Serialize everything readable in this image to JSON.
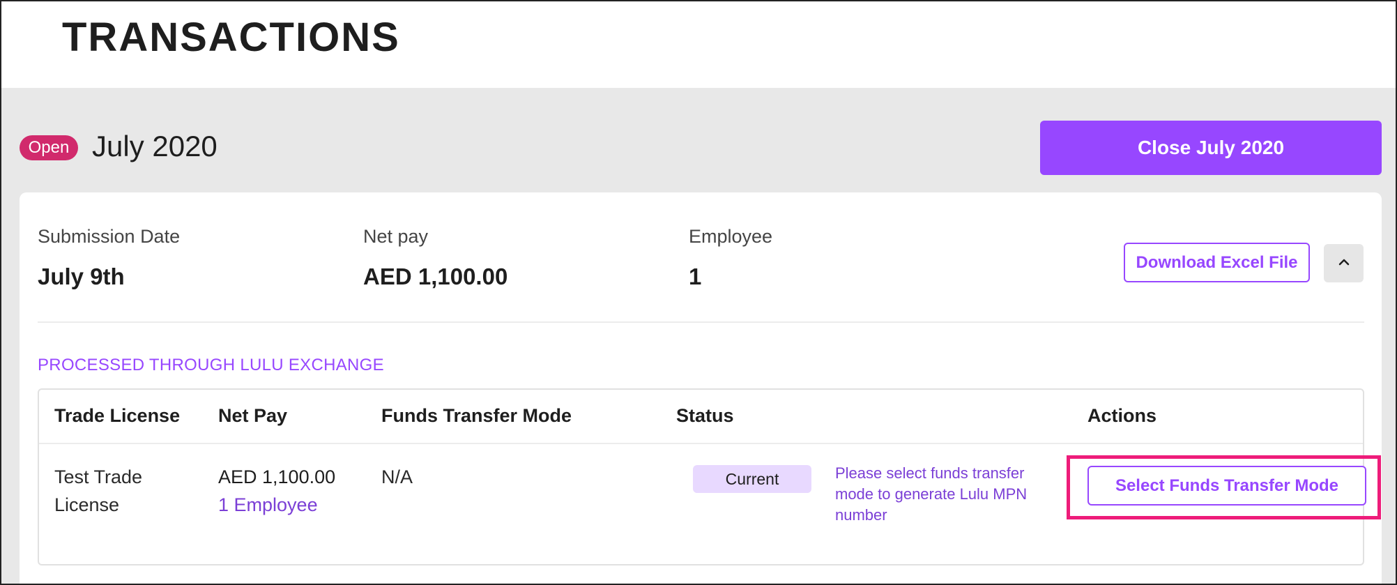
{
  "header": {
    "title": "TRANSACTIONS"
  },
  "period": {
    "status_badge": "Open",
    "title": "July 2020",
    "close_button_label": "Close July 2020"
  },
  "summary": {
    "submission_date_label": "Submission Date",
    "submission_date_value": "July 9th",
    "net_pay_label": "Net pay",
    "net_pay_value": "AED 1,100.00",
    "employee_label": "Employee",
    "employee_value": "1",
    "download_button_label": "Download Excel File",
    "collapse_icon": "chevron-up-icon"
  },
  "section": {
    "label": "PROCESSED THROUGH LULU EXCHANGE"
  },
  "table": {
    "headers": [
      "Trade License",
      "Net Pay",
      "Funds Transfer Mode",
      "Status",
      "Actions"
    ],
    "rows": [
      {
        "trade_license_line1": "Test Trade",
        "trade_license_line2": "License",
        "net_pay": "AED 1,100.00",
        "employee_link": "1 Employee",
        "funds_transfer_mode": "N/A",
        "status": "Current",
        "status_message": "Please select funds transfer mode to generate Lulu MPN number",
        "action_label": "Select Funds Transfer Mode"
      }
    ]
  },
  "colors": {
    "accent": "#9747ff",
    "badge": "#d12a6c",
    "highlight": "#ee1c7a",
    "status_pill": "#e8d9ff"
  }
}
